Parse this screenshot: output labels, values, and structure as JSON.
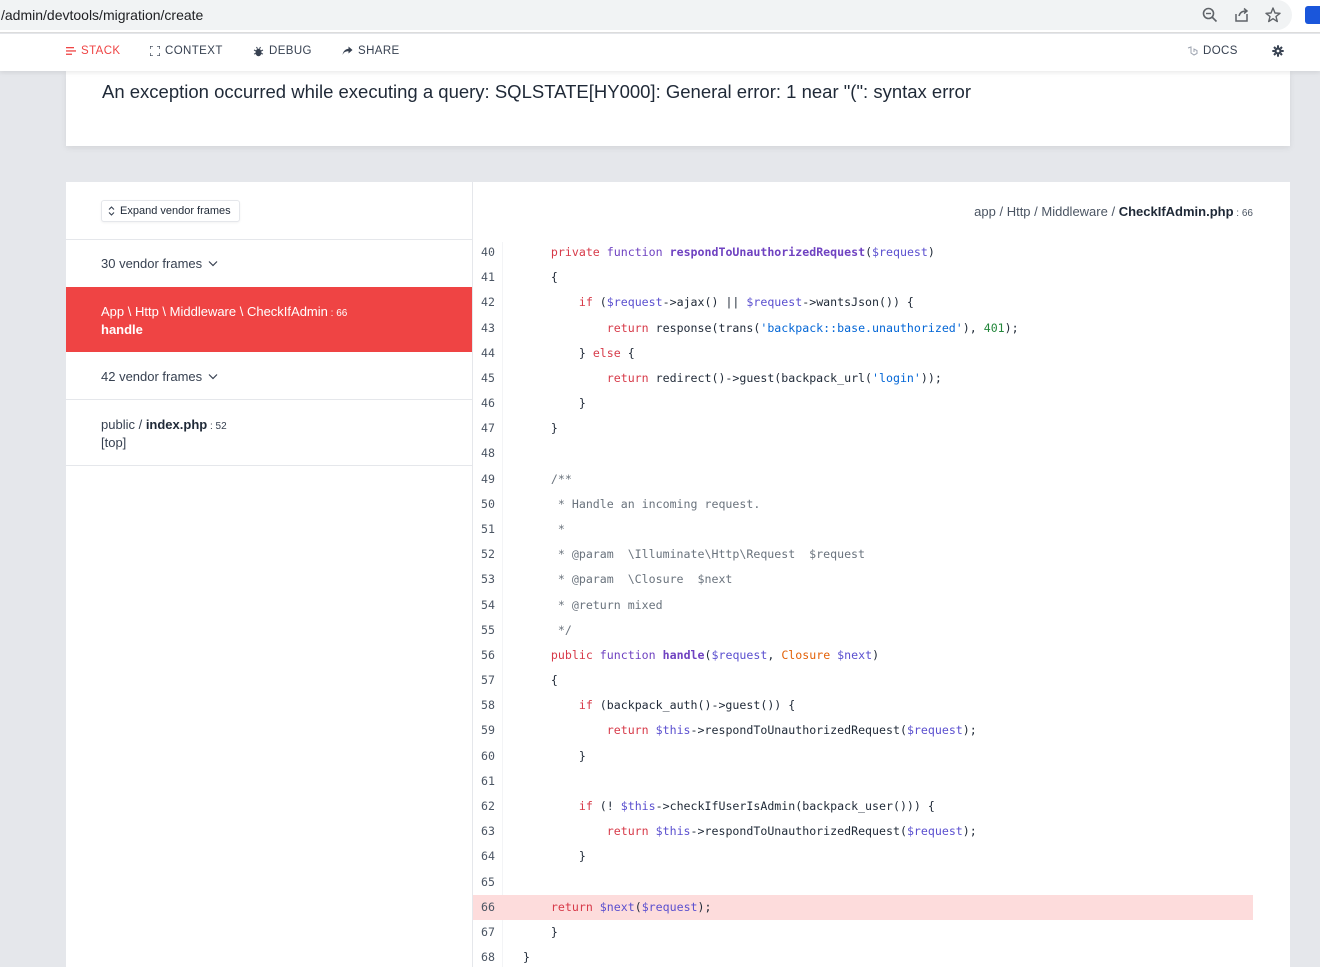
{
  "browser": {
    "url": "/admin/devtools/migration/create"
  },
  "toolbar": {
    "stack": "STACK",
    "context": "CONTEXT",
    "debug": "DEBUG",
    "share": "SHARE",
    "docs": "DOCS"
  },
  "exception": {
    "message": "An exception occurred while executing a query: SQLSTATE[HY000]: General error: 1 near \"(\": syntax error"
  },
  "frames": {
    "expand_label": "Expand vendor frames",
    "vendor_group_1": "30 vendor frames",
    "active": {
      "path_prefix": "App \\ Http \\ Middleware \\ ",
      "file": "CheckIfAdmin",
      "line": "66",
      "method": "handle"
    },
    "vendor_group_2": "42 vendor frames",
    "public": {
      "path_prefix": "public / ",
      "file": "index.php",
      "line": "52",
      "method": "[top]"
    }
  },
  "code": {
    "filepath_prefix": "app / Http / Middleware / ",
    "filepath_file": "CheckIfAdmin.php",
    "filepath_line": "66",
    "highlight_line": 66,
    "lines": [
      {
        "n": "40",
        "t": "    private function respondToUnauthorizedRequest($request)"
      },
      {
        "n": "41",
        "t": "    {"
      },
      {
        "n": "42",
        "t": "        if ($request->ajax() || $request->wantsJson()) {"
      },
      {
        "n": "43",
        "t": "            return response(trans('backpack::base.unauthorized'), 401);"
      },
      {
        "n": "44",
        "t": "        } else {"
      },
      {
        "n": "45",
        "t": "            return redirect()->guest(backpack_url('login'));"
      },
      {
        "n": "46",
        "t": "        }"
      },
      {
        "n": "47",
        "t": "    }"
      },
      {
        "n": "48",
        "t": ""
      },
      {
        "n": "49",
        "t": "    /**"
      },
      {
        "n": "50",
        "t": "     * Handle an incoming request."
      },
      {
        "n": "51",
        "t": "     *"
      },
      {
        "n": "52",
        "t": "     * @param  \\Illuminate\\Http\\Request  $request"
      },
      {
        "n": "53",
        "t": "     * @param  \\Closure  $next"
      },
      {
        "n": "54",
        "t": "     * @return mixed"
      },
      {
        "n": "55",
        "t": "     */"
      },
      {
        "n": "56",
        "t": "    public function handle($request, Closure $next)"
      },
      {
        "n": "57",
        "t": "    {"
      },
      {
        "n": "58",
        "t": "        if (backpack_auth()->guest()) {"
      },
      {
        "n": "59",
        "t": "            return $this->respondToUnauthorizedRequest($request);"
      },
      {
        "n": "60",
        "t": "        }"
      },
      {
        "n": "61",
        "t": ""
      },
      {
        "n": "62",
        "t": "        if (! $this->checkIfUserIsAdmin(backpack_user())) {"
      },
      {
        "n": "63",
        "t": "            return $this->respondToUnauthorizedRequest($request);"
      },
      {
        "n": "64",
        "t": "        }"
      },
      {
        "n": "65",
        "t": ""
      },
      {
        "n": "66",
        "t": "    return $next($request);"
      },
      {
        "n": "67",
        "t": "    }"
      },
      {
        "n": "68",
        "t": "}"
      }
    ]
  },
  "colors": {
    "accent": "#ef4444",
    "highlight_row": "#fddcdc"
  }
}
